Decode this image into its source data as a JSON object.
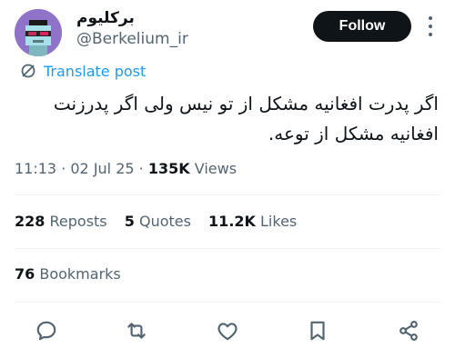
{
  "author": {
    "display_name": "برکلیوم",
    "handle": "@Berkelium_ir",
    "avatar_icon": "pixel-avatar-icon"
  },
  "follow_label": "Follow",
  "translate_label": "Translate post",
  "post_text": "اگر پدرت افغانیه مشکل از تو نیس ولی اگر پدرزنت افغانیه مشکل از توعه.",
  "meta": {
    "time": "11:13",
    "date": "02 Jul 25",
    "views_count": "135K",
    "views_label": "Views"
  },
  "stats": {
    "reposts_count": "228",
    "reposts_label": "Reposts",
    "quotes_count": "5",
    "quotes_label": "Quotes",
    "likes_count": "11.2K",
    "likes_label": "Likes",
    "bookmarks_count": "76",
    "bookmarks_label": "Bookmarks"
  },
  "colors": {
    "accent": "#1d9bf0",
    "text": "#0f1419",
    "secondary": "#536471",
    "follow_bg": "#0f1419"
  },
  "actions": [
    "reply-icon",
    "repost-icon",
    "like-icon",
    "bookmark-icon",
    "share-icon"
  ]
}
